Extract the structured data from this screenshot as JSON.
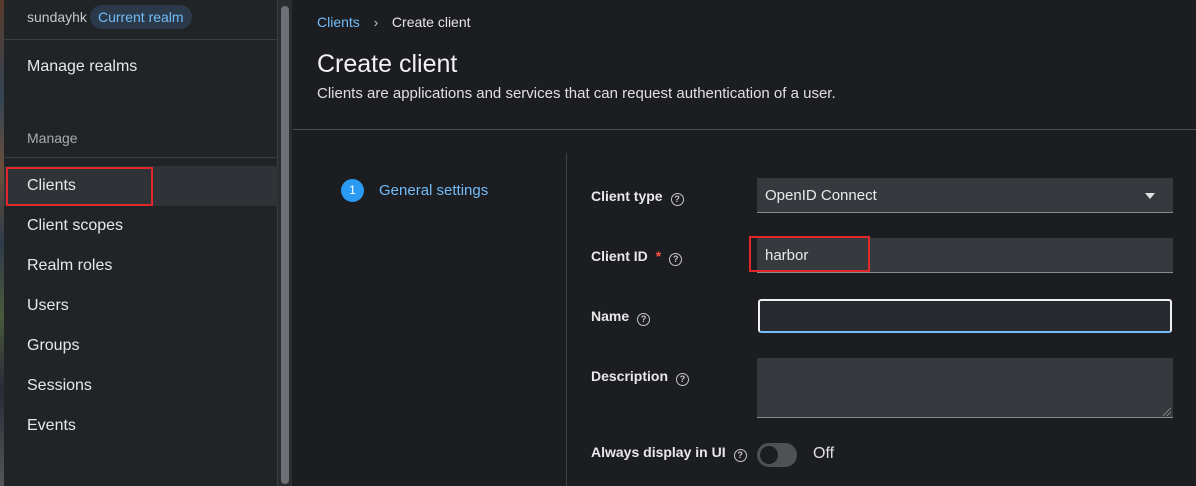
{
  "sidebar": {
    "realm_name": "sundayhk",
    "realm_badge": "Current realm",
    "manage_realms": "Manage realms",
    "manage_heading": "Manage",
    "items": [
      {
        "label": "Clients"
      },
      {
        "label": "Client scopes"
      },
      {
        "label": "Realm roles"
      },
      {
        "label": "Users"
      },
      {
        "label": "Groups"
      },
      {
        "label": "Sessions"
      },
      {
        "label": "Events"
      }
    ]
  },
  "breadcrumb": {
    "link": "Clients",
    "separator": "›",
    "current": "Create client"
  },
  "header": {
    "title": "Create client",
    "description": "Clients are applications and services that can request authentication of a user."
  },
  "wizard": {
    "step_number": "1",
    "step_label": "General settings"
  },
  "form": {
    "client_type_label": "Client type",
    "client_type_value": "OpenID Connect",
    "client_id_label": "Client ID",
    "client_id_required": "*",
    "client_id_value": "harbor",
    "name_label": "Name",
    "name_value": "",
    "description_label": "Description",
    "description_value": "",
    "always_display_label": "Always display in UI",
    "always_display_state": "Off",
    "help_glyph": "?"
  },
  "colors": {
    "accent": "#73bcf7",
    "highlight": "#e0272c",
    "required": "#fe5142"
  }
}
